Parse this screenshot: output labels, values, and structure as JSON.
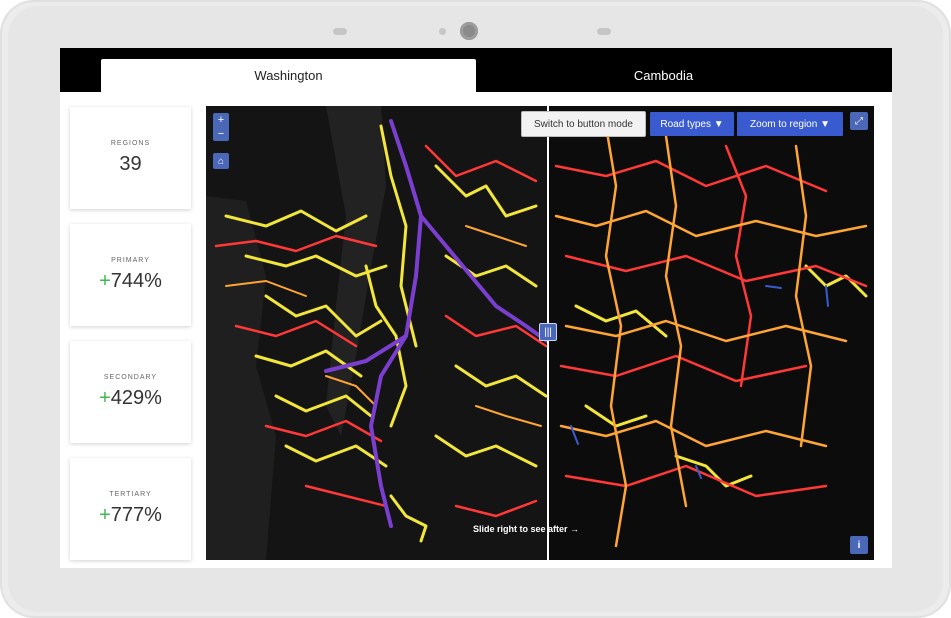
{
  "tabs": [
    {
      "label": "Washington",
      "active": true
    },
    {
      "label": "Cambodia",
      "active": false
    }
  ],
  "stats": [
    {
      "label": "REGIONS",
      "value": "39",
      "sign": ""
    },
    {
      "label": "PRIMARY",
      "value": "744%",
      "sign": "+"
    },
    {
      "label": "SECONDARY",
      "value": "429%",
      "sign": "+"
    },
    {
      "label": "TERTIARY",
      "value": "777%",
      "sign": "+"
    }
  ],
  "map": {
    "switch_button": "Switch to button mode",
    "road_types_button": "Road types ▼",
    "zoom_region_button": "Zoom to region ▼",
    "slide_hint": "Slide right to see after →",
    "zoom_in": "+",
    "zoom_out": "−",
    "info": "i",
    "colors": {
      "primary": "#7b3fd0",
      "secondary": "#ff3838",
      "tertiary": "#f2e63a",
      "other": "#ffa534",
      "accent": "#3a5bd0"
    }
  }
}
